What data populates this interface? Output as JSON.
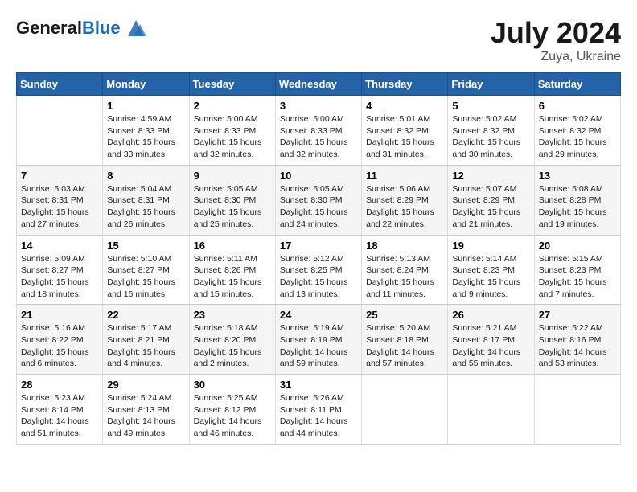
{
  "header": {
    "logo_line1": "General",
    "logo_line2": "Blue",
    "month": "July 2024",
    "location": "Zuya, Ukraine"
  },
  "weekdays": [
    "Sunday",
    "Monday",
    "Tuesday",
    "Wednesday",
    "Thursday",
    "Friday",
    "Saturday"
  ],
  "weeks": [
    [
      {
        "day": "",
        "info": ""
      },
      {
        "day": "1",
        "info": "Sunrise: 4:59 AM\nSunset: 8:33 PM\nDaylight: 15 hours\nand 33 minutes."
      },
      {
        "day": "2",
        "info": "Sunrise: 5:00 AM\nSunset: 8:33 PM\nDaylight: 15 hours\nand 32 minutes."
      },
      {
        "day": "3",
        "info": "Sunrise: 5:00 AM\nSunset: 8:33 PM\nDaylight: 15 hours\nand 32 minutes."
      },
      {
        "day": "4",
        "info": "Sunrise: 5:01 AM\nSunset: 8:32 PM\nDaylight: 15 hours\nand 31 minutes."
      },
      {
        "day": "5",
        "info": "Sunrise: 5:02 AM\nSunset: 8:32 PM\nDaylight: 15 hours\nand 30 minutes."
      },
      {
        "day": "6",
        "info": "Sunrise: 5:02 AM\nSunset: 8:32 PM\nDaylight: 15 hours\nand 29 minutes."
      }
    ],
    [
      {
        "day": "7",
        "info": "Sunrise: 5:03 AM\nSunset: 8:31 PM\nDaylight: 15 hours\nand 27 minutes."
      },
      {
        "day": "8",
        "info": "Sunrise: 5:04 AM\nSunset: 8:31 PM\nDaylight: 15 hours\nand 26 minutes."
      },
      {
        "day": "9",
        "info": "Sunrise: 5:05 AM\nSunset: 8:30 PM\nDaylight: 15 hours\nand 25 minutes."
      },
      {
        "day": "10",
        "info": "Sunrise: 5:05 AM\nSunset: 8:30 PM\nDaylight: 15 hours\nand 24 minutes."
      },
      {
        "day": "11",
        "info": "Sunrise: 5:06 AM\nSunset: 8:29 PM\nDaylight: 15 hours\nand 22 minutes."
      },
      {
        "day": "12",
        "info": "Sunrise: 5:07 AM\nSunset: 8:29 PM\nDaylight: 15 hours\nand 21 minutes."
      },
      {
        "day": "13",
        "info": "Sunrise: 5:08 AM\nSunset: 8:28 PM\nDaylight: 15 hours\nand 19 minutes."
      }
    ],
    [
      {
        "day": "14",
        "info": "Sunrise: 5:09 AM\nSunset: 8:27 PM\nDaylight: 15 hours\nand 18 minutes."
      },
      {
        "day": "15",
        "info": "Sunrise: 5:10 AM\nSunset: 8:27 PM\nDaylight: 15 hours\nand 16 minutes."
      },
      {
        "day": "16",
        "info": "Sunrise: 5:11 AM\nSunset: 8:26 PM\nDaylight: 15 hours\nand 15 minutes."
      },
      {
        "day": "17",
        "info": "Sunrise: 5:12 AM\nSunset: 8:25 PM\nDaylight: 15 hours\nand 13 minutes."
      },
      {
        "day": "18",
        "info": "Sunrise: 5:13 AM\nSunset: 8:24 PM\nDaylight: 15 hours\nand 11 minutes."
      },
      {
        "day": "19",
        "info": "Sunrise: 5:14 AM\nSunset: 8:23 PM\nDaylight: 15 hours\nand 9 minutes."
      },
      {
        "day": "20",
        "info": "Sunrise: 5:15 AM\nSunset: 8:23 PM\nDaylight: 15 hours\nand 7 minutes."
      }
    ],
    [
      {
        "day": "21",
        "info": "Sunrise: 5:16 AM\nSunset: 8:22 PM\nDaylight: 15 hours\nand 6 minutes."
      },
      {
        "day": "22",
        "info": "Sunrise: 5:17 AM\nSunset: 8:21 PM\nDaylight: 15 hours\nand 4 minutes."
      },
      {
        "day": "23",
        "info": "Sunrise: 5:18 AM\nSunset: 8:20 PM\nDaylight: 15 hours\nand 2 minutes."
      },
      {
        "day": "24",
        "info": "Sunrise: 5:19 AM\nSunset: 8:19 PM\nDaylight: 14 hours\nand 59 minutes."
      },
      {
        "day": "25",
        "info": "Sunrise: 5:20 AM\nSunset: 8:18 PM\nDaylight: 14 hours\nand 57 minutes."
      },
      {
        "day": "26",
        "info": "Sunrise: 5:21 AM\nSunset: 8:17 PM\nDaylight: 14 hours\nand 55 minutes."
      },
      {
        "day": "27",
        "info": "Sunrise: 5:22 AM\nSunset: 8:16 PM\nDaylight: 14 hours\nand 53 minutes."
      }
    ],
    [
      {
        "day": "28",
        "info": "Sunrise: 5:23 AM\nSunset: 8:14 PM\nDaylight: 14 hours\nand 51 minutes."
      },
      {
        "day": "29",
        "info": "Sunrise: 5:24 AM\nSunset: 8:13 PM\nDaylight: 14 hours\nand 49 minutes."
      },
      {
        "day": "30",
        "info": "Sunrise: 5:25 AM\nSunset: 8:12 PM\nDaylight: 14 hours\nand 46 minutes."
      },
      {
        "day": "31",
        "info": "Sunrise: 5:26 AM\nSunset: 8:11 PM\nDaylight: 14 hours\nand 44 minutes."
      },
      {
        "day": "",
        "info": ""
      },
      {
        "day": "",
        "info": ""
      },
      {
        "day": "",
        "info": ""
      }
    ]
  ]
}
